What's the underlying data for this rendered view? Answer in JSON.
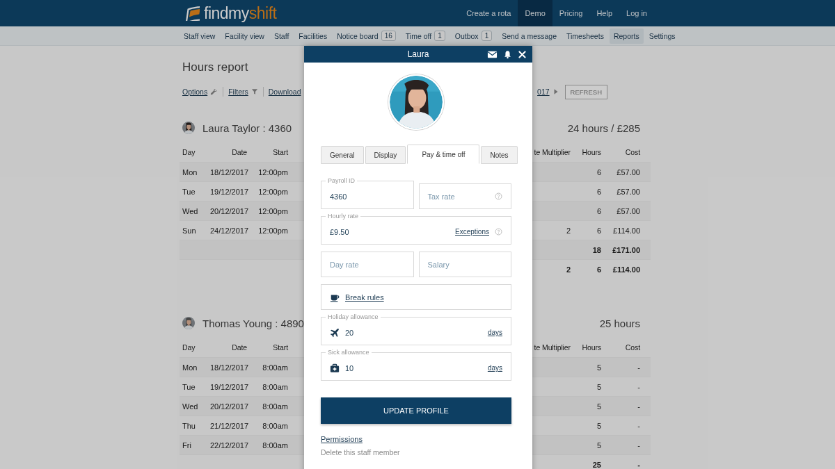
{
  "header": {
    "logo": {
      "primary": "findmy",
      "accent": "shift"
    },
    "links": [
      {
        "label": "Create a rota",
        "selected": false
      },
      {
        "label": "Demo",
        "selected": true
      },
      {
        "label": "Pricing",
        "selected": false
      },
      {
        "label": "Help",
        "selected": false
      },
      {
        "label": "Log in",
        "selected": false
      }
    ]
  },
  "subnav": [
    {
      "label": "Staff view",
      "selected": false
    },
    {
      "label": "Facility view",
      "selected": false
    },
    {
      "label": "Staff",
      "selected": false
    },
    {
      "label": "Facilities",
      "selected": false
    },
    {
      "label": "Notice board",
      "badge": "16",
      "selected": false
    },
    {
      "label": "Time off",
      "badge": "1",
      "selected": false
    },
    {
      "label": "Outbox",
      "badge": "1",
      "selected": false
    },
    {
      "label": "Send a message",
      "selected": false
    },
    {
      "label": "Timesheets",
      "selected": false
    },
    {
      "label": "Reports",
      "selected": true
    },
    {
      "label": "Settings",
      "selected": false
    }
  ],
  "report": {
    "title": "Hours report",
    "toolbar": {
      "options": "Options",
      "filters": "Filters",
      "download": "Download",
      "period": "017",
      "refresh": "REFRESH"
    },
    "staff": [
      {
        "name": "Laura Taylor : 4360",
        "total": "24 hours / £285",
        "columns": [
          "Day",
          "Date",
          "Start",
          "te Multiplier",
          "Hours",
          "Cost"
        ],
        "rows": [
          {
            "kind": "shift",
            "day": "Mon",
            "date": "18/12/2017",
            "start": "12:00pm",
            "hours": "6",
            "cost": "£57.00"
          },
          {
            "kind": "shift",
            "day": "Tue",
            "date": "19/12/2017",
            "start": "12:00pm",
            "hours": "6",
            "cost": "£57.00"
          },
          {
            "kind": "shift",
            "day": "Wed",
            "date": "20/12/2017",
            "start": "12:00pm",
            "hours": "6",
            "cost": "£57.00"
          },
          {
            "kind": "shift",
            "day": "Sun",
            "date": "24/12/2017",
            "start": "12:00pm",
            "multiplier": "2",
            "hours": "6",
            "cost": "£114.00"
          },
          {
            "kind": "total",
            "hours": "18",
            "cost": "£171.00"
          },
          {
            "kind": "total",
            "multiplier": "2",
            "hours": "6",
            "cost": "£114.00"
          }
        ]
      },
      {
        "name": "Thomas Young : 4890",
        "total": "25 hours",
        "columns": [
          "Day",
          "Date",
          "Start",
          "te Multiplier",
          "Hours",
          "Cost"
        ],
        "rows": [
          {
            "kind": "shift",
            "day": "Mon",
            "date": "18/12/2017",
            "start": "8:00am",
            "hours": "5",
            "cost": "-"
          },
          {
            "kind": "shift",
            "day": "Tue",
            "date": "19/12/2017",
            "start": "8:00am",
            "hours": "5",
            "cost": "-"
          },
          {
            "kind": "shift",
            "day": "Wed",
            "date": "20/12/2017",
            "start": "8:00am",
            "hours": "5",
            "cost": "-"
          },
          {
            "kind": "shift",
            "day": "Thu",
            "date": "21/12/2017",
            "start": "8:00am",
            "hours": "5",
            "cost": "-"
          },
          {
            "kind": "shift",
            "day": "Fri",
            "date": "22/12/2017",
            "start": "8:00am",
            "hours": "5",
            "cost": "-"
          },
          {
            "kind": "total",
            "hours": "25",
            "cost": "-"
          }
        ]
      }
    ]
  },
  "modal": {
    "title": "Laura",
    "tabs": [
      {
        "label": "General",
        "selected": false
      },
      {
        "label": "Display",
        "selected": false
      },
      {
        "label": "Pay & time off",
        "selected": true
      },
      {
        "label": "Notes",
        "selected": false
      }
    ],
    "fields": [
      {
        "kind": "pair",
        "items": [
          {
            "label": "Payroll ID",
            "value": "4360",
            "help": false
          },
          {
            "placeholder": "Tax rate",
            "help": true
          }
        ]
      },
      {
        "kind": "rate",
        "label": "Hourly rate",
        "value": "£9.50",
        "link": "Exceptions",
        "help": true
      },
      {
        "kind": "pair",
        "items": [
          {
            "placeholder": "Day rate",
            "help": false
          },
          {
            "placeholder": "Salary",
            "help": false
          }
        ]
      },
      {
        "kind": "break",
        "link": "Break rules"
      },
      {
        "kind": "holiday",
        "label": "Holiday allowance",
        "value": "20",
        "link": "days"
      },
      {
        "kind": "sick",
        "label": "Sick allowance",
        "value": "10",
        "link": "days"
      }
    ],
    "submit": "UPDATE PROFILE",
    "links": [
      {
        "kind": "link",
        "label": "Permissions"
      },
      {
        "kind": "muted",
        "label": "Delete this staff member"
      }
    ]
  }
}
